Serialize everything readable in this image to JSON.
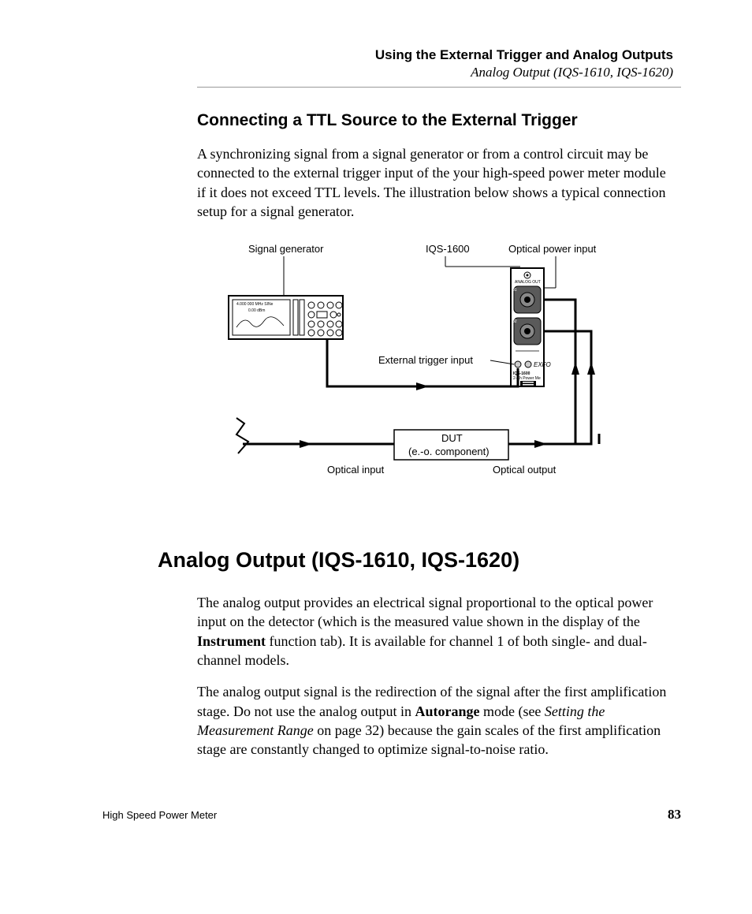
{
  "header": {
    "title": "Using the External Trigger and Analog Outputs",
    "subtitle": "Analog Output (IQS-1610, IQS-1620)"
  },
  "section1": {
    "heading": "Connecting a TTL Source to the External Trigger",
    "paragraph": "A synchronizing signal from a signal generator or from a control circuit may be connected to the external trigger input of the your high-speed power meter module if it does not exceed TTL levels. The illustration below shows a typical connection setup for a signal generator."
  },
  "diagram": {
    "labels": {
      "signal_generator": "Signal generator",
      "iqs1600": "IQS-1600",
      "optical_power_input": "Optical power input",
      "external_trigger_input": "External trigger input",
      "dut_title": "DUT",
      "dut_sub": "(e.-o. component)",
      "optical_input": "Optical input",
      "optical_output": "Optical output"
    },
    "device_labels": {
      "gen_screen_line1": "4.000 000 MHz SINe",
      "gen_screen_line2": "0.00 dBm",
      "iqs_analog_out": "ANALOG OUT",
      "iqs_port1": "01",
      "iqs_port2": "02",
      "iqs_model": "IQS-1600",
      "iqs_desc": "2-Ch Power Me"
    }
  },
  "section2": {
    "heading": "Analog Output (IQS-1610, IQS-1620)",
    "p1_pre": "The analog output provides an electrical signal proportional to the optical power input on the detector (which is the measured value shown in the display of the ",
    "p1_bold": "Instrument",
    "p1_post": " function tab). It is available for channel 1 of both single- and dual-channel models.",
    "p2_pre": "The analog output signal is the redirection of the signal after the first amplification stage. Do not use the analog output in ",
    "p2_bold": "Autorange",
    "p2_mid": " mode (see ",
    "p2_italic": "Setting the Measurement Range",
    "p2_post": " on page 32) because the gain scales of the first amplification stage are constantly changed to optimize signal-to-noise ratio."
  },
  "footer": {
    "left": "High Speed Power Meter",
    "right": "83"
  }
}
